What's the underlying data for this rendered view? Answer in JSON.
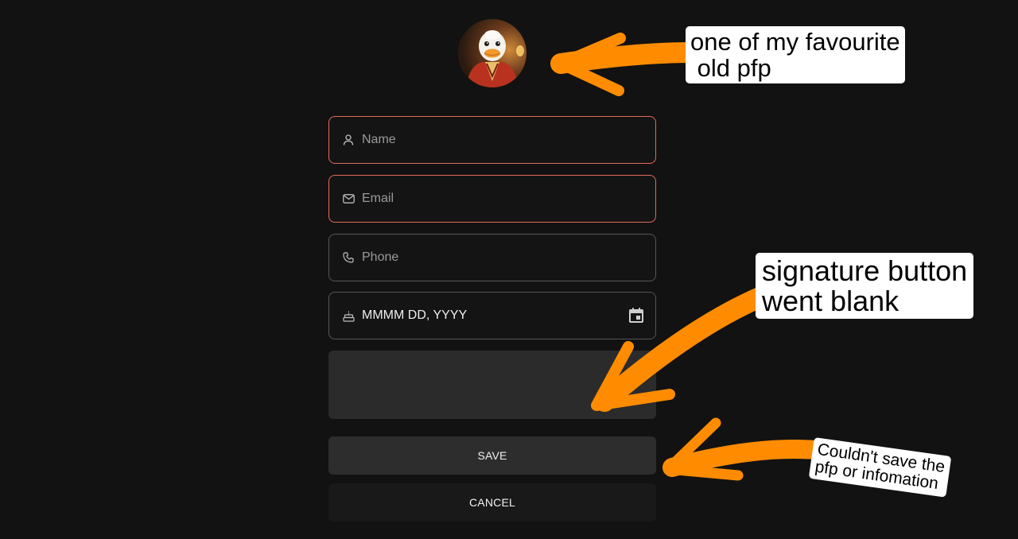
{
  "profile": {
    "avatar_icon": "duck-avatar-image"
  },
  "form": {
    "name": {
      "placeholder": "Name",
      "icon": "person-icon"
    },
    "email": {
      "placeholder": "Email",
      "icon": "mail-icon"
    },
    "phone": {
      "placeholder": "Phone",
      "icon": "phone-icon"
    },
    "birthday": {
      "value": "MMMM DD, YYYY",
      "icon": "cake-icon",
      "picker_icon": "calendar-icon"
    },
    "signature": {
      "value": ""
    }
  },
  "buttons": {
    "save_label": "SAVE",
    "cancel_label": "CANCEL"
  },
  "annotations": {
    "avatar_note": "one of my favourite\n old pfp",
    "signature_note": "signature button\nwent blank",
    "save_note": "Couldn't save the\npfp or infomation"
  },
  "colors": {
    "background": "#121212",
    "error_border": "#e26a5c",
    "annotation_arrow": "#ff8c00",
    "annotation_label_bg": "#ffffff"
  }
}
